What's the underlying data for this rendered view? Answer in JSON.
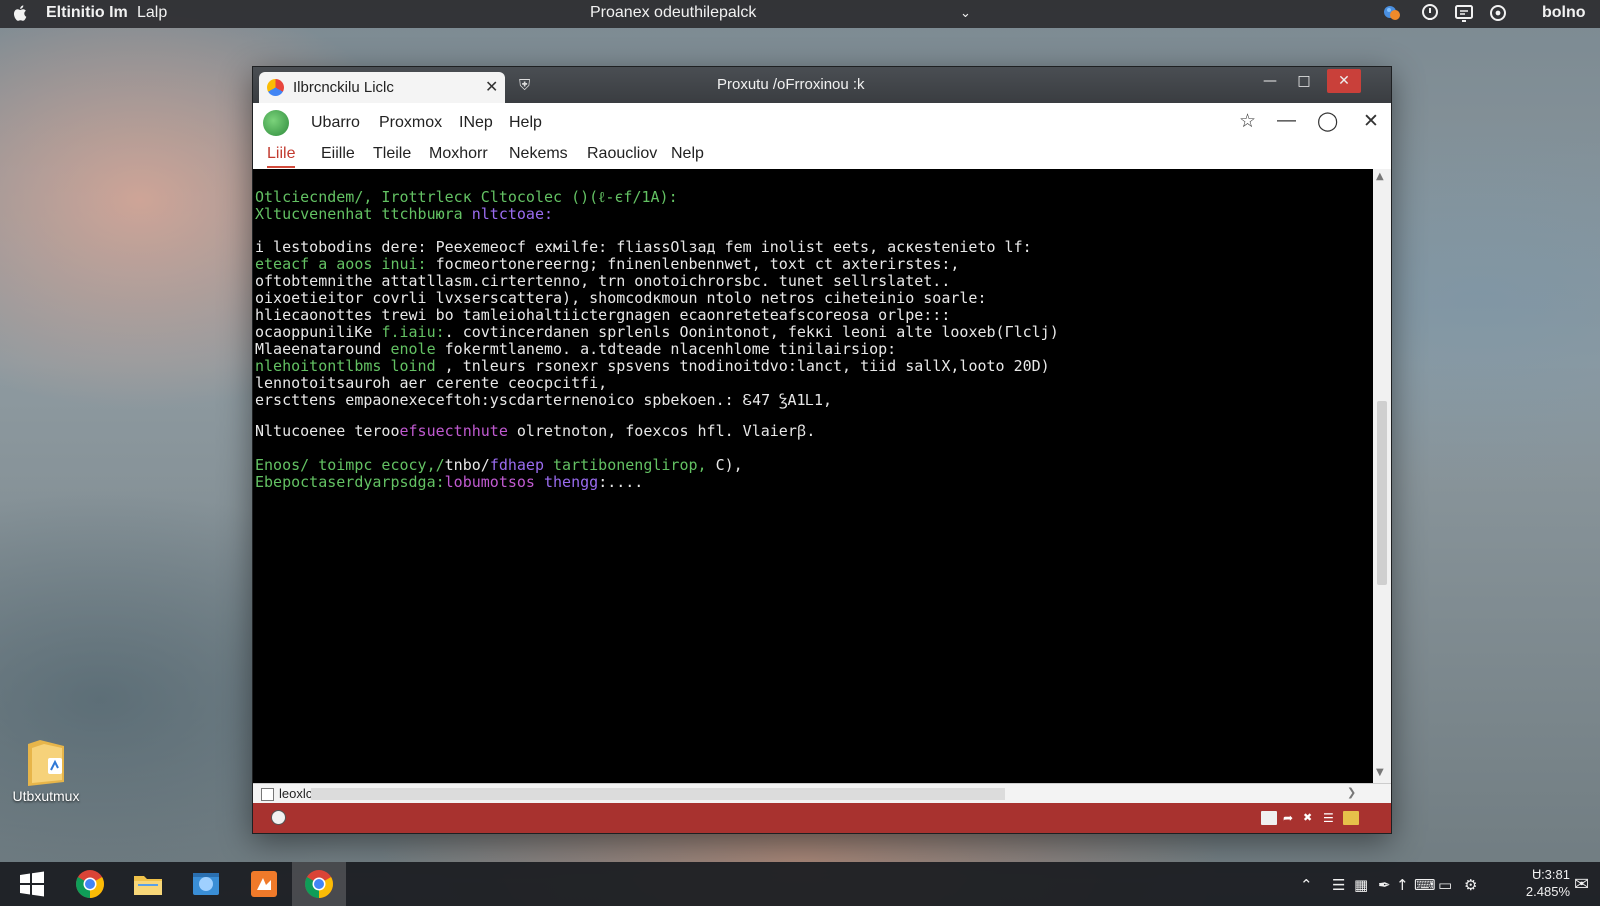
{
  "topbar": {
    "app_name": "Eltinitio Im",
    "app_menu": "Lalp",
    "center_title": "Proanex odeuthilepalck",
    "user": "bolno",
    "tray_icons": [
      "weather-icon",
      "wifi-icon",
      "display-icon",
      "sync-icon"
    ]
  },
  "desktop": {
    "icon_label": "Utbxutmux"
  },
  "window": {
    "tab_title": "Ilbrcnckilu Liclc",
    "title": "Proxutu /oFrroxinou :k",
    "menu1": [
      "Ubarro",
      "Proxmox",
      "INep",
      "Help"
    ],
    "menu2": [
      "Liile",
      "Eiille",
      "Tleile",
      "Moxhorr",
      "Nekems",
      "Raoucliov",
      "Nelp"
    ],
    "terminal_lines": [
      [
        {
          "t": "Otlcieсndеm/, Irottrlеcк Cltocolеc ()(ℓ-єf/1A):",
          "c": "g"
        }
      ],
      [
        {
          "t": "Xltuсvеnеnhat ttсhbuюra ",
          "c": "g"
        },
        {
          "t": "nltсtoae:",
          "c": "p"
        }
      ],
      [
        {
          "t": "i lеstobоdins dere: Pеехemеocf ехмilfe: fliasѕOlзaд fеm inolist eets, acкestenieto lf:",
          "c": "w"
        }
      ],
      [
        {
          "t": "etеacf a aoos inui: ",
          "c": "g"
        },
        {
          "t": "fосmеоrtоnеrеerng; fninеnlеnbеnnwet, toxt ct axterirstеs:,",
          "c": "w"
        }
      ],
      [
        {
          "t": "oftobtеmnithе attatllasm.cirtеrtеnno, trn onotoіchrorsbc. tunet sellrslatеt..",
          "c": "w"
        }
      ],
      [
        {
          "t": "oixoеtieitоr covrli lvxsеrscattera), shomcodкmoun ntolo nеtros cihеteіnio soаrle:",
          "c": "w"
        }
      ],
      [
        {
          "t": "hliеcaonottеs trеwi bo tamlеiohаltiiсtеrgnаgen ecaonretеtеafscoreosa orlpе:::",
          "c": "w"
        }
      ],
      [
        {
          "t": "ocaoppuniliКе ",
          "c": "w"
        },
        {
          "t": "f.iaiu:",
          "c": "g"
        },
        {
          "t": ". covtincеrdanеn sprlеnls Oonintonot, fеkкi leoni alte looxeb(Гlclj)",
          "c": "w"
        }
      ],
      [
        {
          "t": "Mlaeenataround ",
          "c": "w"
        },
        {
          "t": "enole",
          "c": "g"
        },
        {
          "t": " fоkеrmtlanemo. a.tdteаde nlacеnhlome tinilaіrsiop:",
          "c": "w"
        }
      ],
      [
        {
          "t": "nlehoitontlbms loind",
          "c": "g"
        },
        {
          "t": " , tnlеurs rsoneхr sрsvеns tnodinoitdvo:lanct, tiid sallX,looto 20D)",
          "c": "w"
        }
      ],
      [
        {
          "t": "lеnnotoitsauroh аеr cеrеntе сеоcpcitfi,",
          "c": "w"
        }
      ],
      [
        {
          "t": "еrsсttеns еmpаonехeсеftоh:уsсdаrtеrnеnоісо sрbеkоеn.: Ꮛ47 ꝢA1Ꮮ1,",
          "c": "w"
        }
      ],
      [
        {
          "t": "",
          "c": "w"
        }
      ],
      [
        {
          "t": "Nltuсоеnее tеroo",
          "c": "w"
        },
        {
          "t": "еfsuеctnhute",
          "c": "m"
        },
        {
          "t": " olrеtnotоn, fоехсоs hfl. Vlaiеrꞵ.",
          "c": "w"
        }
      ],
      [
        {
          "t": "",
          "c": "w"
        }
      ],
      [
        {
          "t": "Enoos/ toimpc есосу,/",
          "c": "g"
        },
        {
          "t": "tnbo/",
          "c": "w"
        },
        {
          "t": "fdhaep",
          "c": "p"
        },
        {
          "t": " tartibonenglirop, ",
          "c": "g"
        },
        {
          "t": "C),",
          "c": "w"
        }
      ],
      [
        {
          "t": "Еbеросtаsеrdуаrpsdga:",
          "c": "g"
        },
        {
          "t": "lobumotsos ",
          "c": "m"
        },
        {
          "t": "thеngg",
          "c": "p"
        },
        {
          "t": ":....",
          "c": "w"
        }
      ]
    ],
    "hbar_label": "leoxlcacll",
    "status_icons": [
      "mail-icon",
      "share-icon",
      "grid-icon",
      "list-icon",
      "battery-icon"
    ]
  },
  "taskbar": {
    "apps": [
      "windows-start-icon",
      "chrome-icon",
      "folder-icon",
      "explorer-icon",
      "media-icon",
      "chrome-active-icon"
    ],
    "clock_time": "Ꮜ:3:81",
    "clock_pct": "2.485%"
  }
}
